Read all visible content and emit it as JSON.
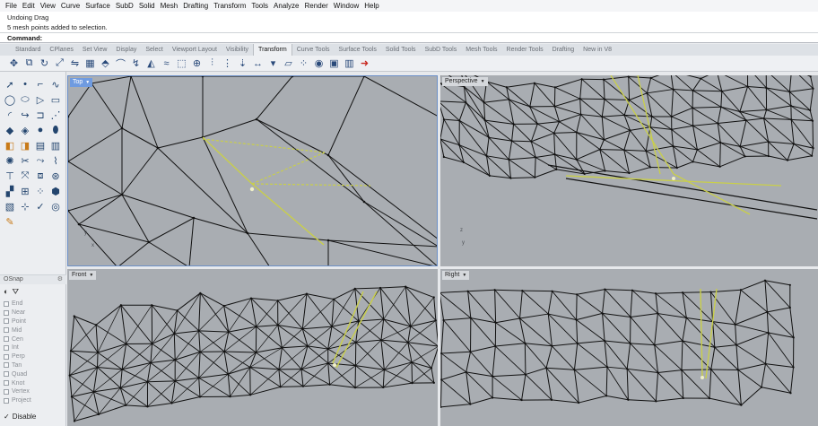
{
  "menu": [
    "File",
    "Edit",
    "View",
    "Curve",
    "Surface",
    "SubD",
    "Solid",
    "Mesh",
    "Drafting",
    "Transform",
    "Tools",
    "Analyze",
    "Render",
    "Window",
    "Help"
  ],
  "history": {
    "line1": "Undoing Drag",
    "line2": "5 mesh points added to selection."
  },
  "command": {
    "label": "Command:"
  },
  "tabs": [
    "Standard",
    "CPlanes",
    "Set View",
    "Display",
    "Select",
    "Viewport Layout",
    "Visibility",
    "Transform",
    "Curve Tools",
    "Surface Tools",
    "Solid Tools",
    "SubD Tools",
    "Mesh Tools",
    "Render Tools",
    "Drafting",
    "New in V8"
  ],
  "active_tab": "Transform",
  "toolbar_icons": [
    "move-icon",
    "copy-icon",
    "rotate-icon",
    "scale-icon",
    "mirror-icon",
    "array-icon",
    "orient-icon",
    "bend-icon",
    "twist-icon",
    "taper-icon",
    "flow-icon",
    "cage-icon",
    "soft-move-icon",
    "align-icon",
    "arrange-icon",
    "project-icon",
    "stretch-icon",
    "smash-icon",
    "shear-icon",
    "set-points-icon",
    "gumball-icon",
    "transform-icon",
    "explode-icon",
    "pull-icon"
  ],
  "osnap": {
    "title": "OSnap",
    "items": [
      "End",
      "Near",
      "Point",
      "Mid",
      "Cen",
      "Int",
      "Perp",
      "Tan",
      "Quad",
      "Knot",
      "Vertex",
      "Project"
    ],
    "disable_label": "Disable"
  },
  "viewports": {
    "top": "Top",
    "perspective": "Perspective",
    "front": "Front",
    "right": "Right"
  },
  "axes": {
    "x": "x",
    "y": "y",
    "z": "z"
  },
  "colors": {
    "viewport_bg": "#a9adb2",
    "wire": "#111111",
    "highlight": "#c9cf4a",
    "active_label": "#6f9be0"
  }
}
